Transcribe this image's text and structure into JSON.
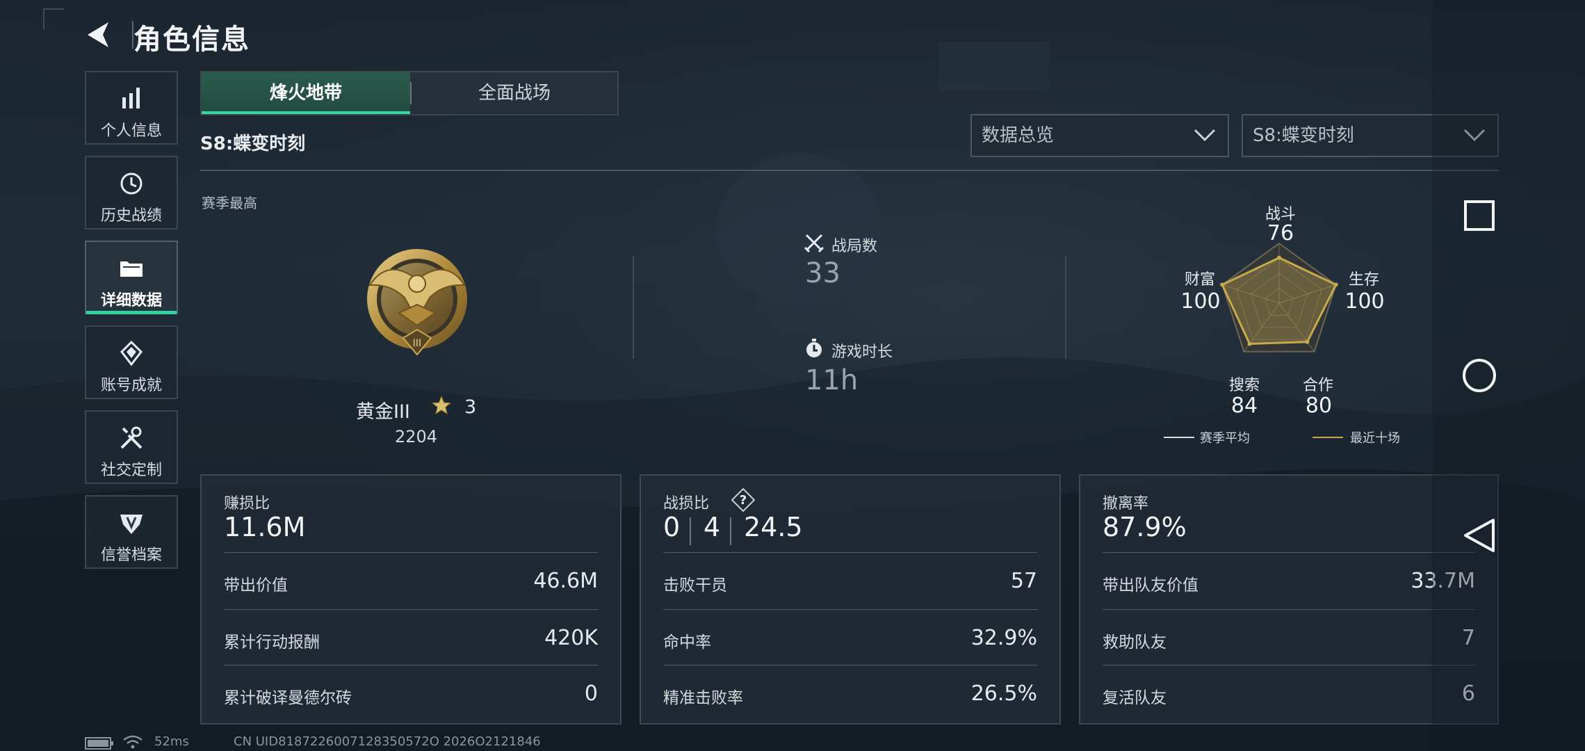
{
  "header": {
    "title": "角色信息"
  },
  "sidebar": {
    "items": [
      {
        "label": "个人信息",
        "icon": "bar-chart-icon"
      },
      {
        "label": "历史战绩",
        "icon": "history-clock-icon"
      },
      {
        "label": "详细数据",
        "icon": "folder-icon",
        "active": true
      },
      {
        "label": "账号成就",
        "icon": "achievement-icon"
      },
      {
        "label": "社交定制",
        "icon": "tools-icon"
      },
      {
        "label": "信誉档案",
        "icon": "shield-wings-icon"
      }
    ]
  },
  "tabs": [
    {
      "label": "烽火地带",
      "active": true
    },
    {
      "label": "全面战场",
      "active": false
    }
  ],
  "season_label": "S8:蝶变时刻",
  "filters": {
    "view": "数据总览",
    "season": "S8:蝶变时刻"
  },
  "season_best": {
    "label": "赛季最高",
    "rank_name": "黄金III",
    "rank_stars": "3",
    "rank_score": "2204",
    "badge_numeral": "III"
  },
  "stats": {
    "matches_label": "战局数",
    "matches_value": "33",
    "playtime_label": "游戏时长",
    "playtime_value": "11h"
  },
  "radar": {
    "axes": [
      {
        "label": "战斗",
        "value": 76
      },
      {
        "label": "生存",
        "value": 100
      },
      {
        "label": "合作",
        "value": 80
      },
      {
        "label": "搜索",
        "value": 84
      },
      {
        "label": "财富",
        "value": 100
      }
    ],
    "max": 100,
    "legend": {
      "season_avg": "赛季平均",
      "recent": "最近十场"
    },
    "colors": {
      "recent": "#c9a94e",
      "season_avg": "#d8dde2"
    }
  },
  "cards": {
    "profit": {
      "title": "赚损比",
      "big": "11.6M",
      "rows": [
        {
          "label": "带出价值",
          "value": "46.6M"
        },
        {
          "label": "累计行动报酬",
          "value": "420K"
        },
        {
          "label": "累计破译曼德尔砖",
          "value": "0"
        }
      ]
    },
    "kd": {
      "title": "战损比",
      "help": "?",
      "parts": [
        "0",
        "4",
        "24.5"
      ],
      "rows": [
        {
          "label": "击败干员",
          "value": "57"
        },
        {
          "label": "命中率",
          "value": "32.9%"
        },
        {
          "label": "精准击败率",
          "value": "26.5%"
        }
      ]
    },
    "extract": {
      "title": "撤离率",
      "big": "87.9%",
      "rows": [
        {
          "label": "带出队友价值",
          "value": "33.7M"
        },
        {
          "label": "救助队友",
          "value": "7"
        },
        {
          "label": "复活队友",
          "value": "6"
        }
      ]
    }
  },
  "footer": {
    "ping": "52ms",
    "uid": "CN UID8187226007128350572O 2026O2121846"
  },
  "accent": "#34d2a0"
}
